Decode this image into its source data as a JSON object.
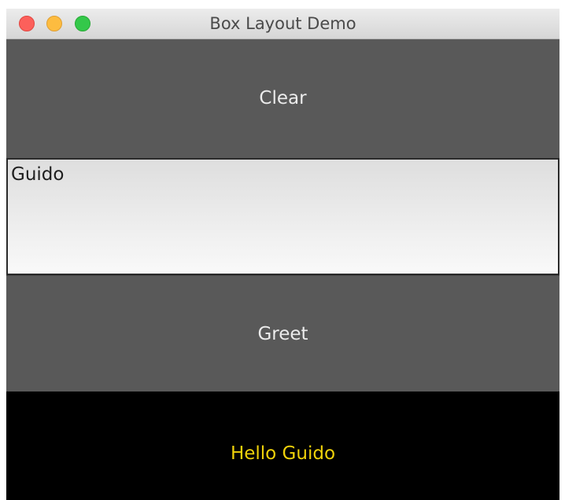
{
  "window": {
    "title": "Box Layout Demo"
  },
  "clear_button": {
    "label": "Clear"
  },
  "name_entry": {
    "value": "Guido"
  },
  "greet_button": {
    "label": "Greet"
  },
  "greeting": {
    "text": "Hello Guido",
    "color": "#f0d20a"
  },
  "colors": {
    "button_bg": "#595959",
    "output_bg": "#000000"
  }
}
